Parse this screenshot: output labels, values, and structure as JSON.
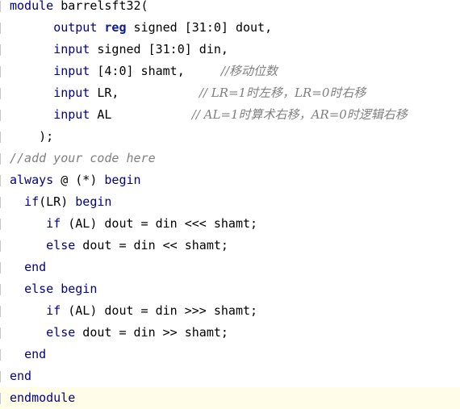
{
  "editor": {
    "lines": [
      {
        "segments": [
          {
            "t": "kw",
            "v": "module"
          },
          {
            "t": "txt",
            "v": " barrelsft32("
          }
        ]
      },
      {
        "segments": [
          {
            "t": "txt",
            "v": "      "
          },
          {
            "t": "kw",
            "v": "output"
          },
          {
            "t": "txt",
            "v": " "
          },
          {
            "t": "kwb",
            "v": "reg"
          },
          {
            "t": "txt",
            "v": " signed [31:0] dout,"
          }
        ]
      },
      {
        "segments": [
          {
            "t": "txt",
            "v": "      "
          },
          {
            "t": "kw",
            "v": "input"
          },
          {
            "t": "txt",
            "v": " signed [31:0] din,"
          }
        ]
      },
      {
        "segments": [
          {
            "t": "txt",
            "v": "      "
          },
          {
            "t": "kw",
            "v": "input"
          },
          {
            "t": "txt",
            "v": " [4:0] shamt,     "
          },
          {
            "t": "cmt",
            "v": "//移动位数"
          }
        ]
      },
      {
        "segments": [
          {
            "t": "txt",
            "v": "      "
          },
          {
            "t": "kw",
            "v": "input"
          },
          {
            "t": "txt",
            "v": " LR,           "
          },
          {
            "t": "cmt",
            "v": "// LR=1时左移，LR=0时右移"
          }
        ]
      },
      {
        "segments": [
          {
            "t": "txt",
            "v": "      "
          },
          {
            "t": "kw",
            "v": "input"
          },
          {
            "t": "txt",
            "v": " AL           "
          },
          {
            "t": "cmt",
            "v": "// AL=1时算术右移，AR=0时逻辑右移"
          }
        ]
      },
      {
        "segments": [
          {
            "t": "txt",
            "v": "    );"
          }
        ]
      },
      {
        "segments": [
          {
            "t": "cmt",
            "v": "//add your code here"
          }
        ]
      },
      {
        "segments": [
          {
            "t": "kw",
            "v": "always"
          },
          {
            "t": "txt",
            "v": " @ (*) "
          },
          {
            "t": "kw",
            "v": "begin"
          }
        ]
      },
      {
        "segments": [
          {
            "t": "txt",
            "v": "  "
          },
          {
            "t": "kw",
            "v": "if"
          },
          {
            "t": "txt",
            "v": "(LR) "
          },
          {
            "t": "kw",
            "v": "begin"
          }
        ]
      },
      {
        "segments": [
          {
            "t": "txt",
            "v": "     "
          },
          {
            "t": "kw",
            "v": "if"
          },
          {
            "t": "txt",
            "v": " (AL) dout = din <<< shamt;"
          }
        ]
      },
      {
        "segments": [
          {
            "t": "txt",
            "v": "     "
          },
          {
            "t": "kw",
            "v": "else"
          },
          {
            "t": "txt",
            "v": " dout = din << shamt;"
          }
        ]
      },
      {
        "segments": [
          {
            "t": "txt",
            "v": "  "
          },
          {
            "t": "kw",
            "v": "end"
          }
        ]
      },
      {
        "segments": [
          {
            "t": "txt",
            "v": "  "
          },
          {
            "t": "kw",
            "v": "else"
          },
          {
            "t": "txt",
            "v": " "
          },
          {
            "t": "kw",
            "v": "begin"
          }
        ]
      },
      {
        "segments": [
          {
            "t": "txt",
            "v": "     "
          },
          {
            "t": "kw",
            "v": "if"
          },
          {
            "t": "txt",
            "v": " (AL) dout = din >>> shamt;"
          }
        ]
      },
      {
        "segments": [
          {
            "t": "txt",
            "v": "     "
          },
          {
            "t": "kw",
            "v": "else"
          },
          {
            "t": "txt",
            "v": " dout = din >> shamt;"
          }
        ]
      },
      {
        "segments": [
          {
            "t": "txt",
            "v": "  "
          },
          {
            "t": "kw",
            "v": "end"
          }
        ]
      },
      {
        "segments": [
          {
            "t": "kw",
            "v": "end"
          }
        ]
      },
      {
        "segments": [
          {
            "t": "kw",
            "v": "endmodule"
          }
        ]
      }
    ],
    "current_line_index": 18,
    "colors": {
      "keyword": "#00008b",
      "comment": "#808080",
      "text": "#000000",
      "current_line_bg": "#fffde8"
    }
  }
}
